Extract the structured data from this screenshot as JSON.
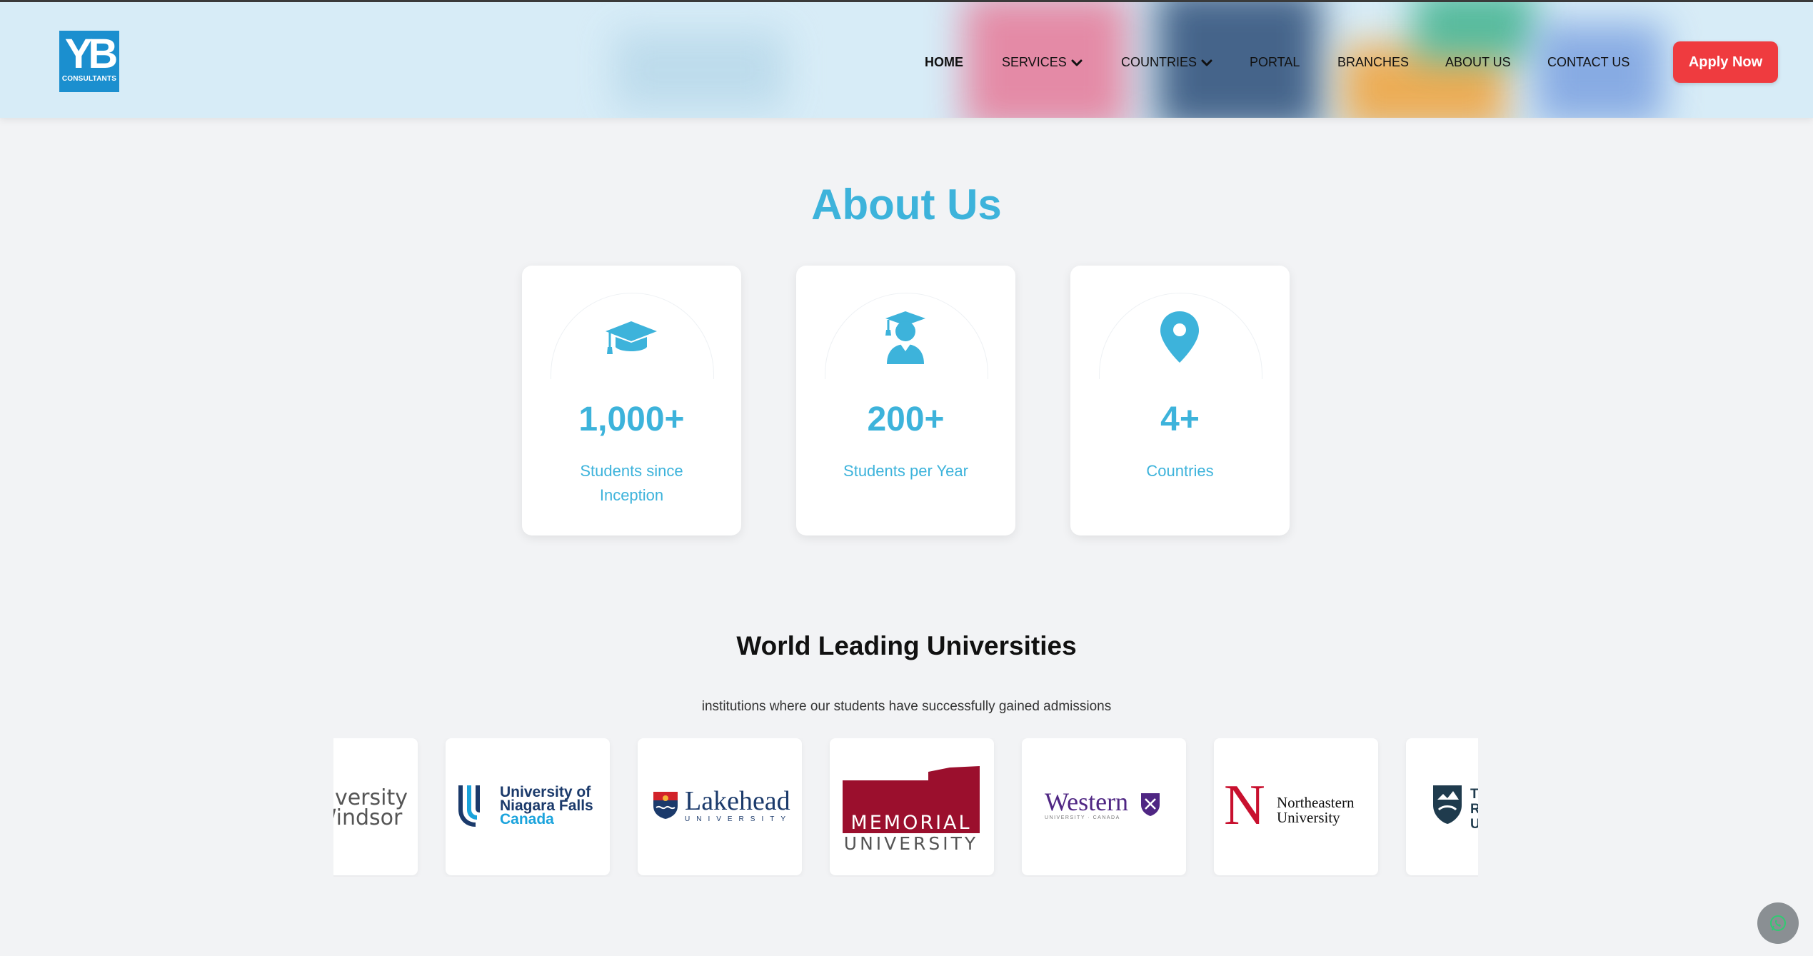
{
  "colors": {
    "accent": "#3db3db",
    "apply_button": "#ef3b3f",
    "header_bg": "#d7ecf7",
    "logo_bg": "#1b8fcf",
    "page_bg": "#f2f3f5"
  },
  "header": {
    "logo": {
      "mark": "YB",
      "subtitle": "CONSULTANTS"
    },
    "nav": [
      {
        "label": "HOME",
        "active": true
      },
      {
        "label": "SERVICES",
        "dropdown": true
      },
      {
        "label": "COUNTRIES",
        "dropdown": true
      },
      {
        "label": "PORTAL"
      },
      {
        "label": "BRANCHES"
      },
      {
        "label": "ABOUT US"
      },
      {
        "label": "CONTACT US"
      }
    ],
    "apply_label": "Apply Now"
  },
  "about": {
    "title": "About Us",
    "stats": [
      {
        "icon": "graduation-cap-icon",
        "value": "1,000+",
        "label": "Students since Inception"
      },
      {
        "icon": "graduate-student-icon",
        "value": "200+",
        "label": "Students per Year"
      },
      {
        "icon": "location-pin-icon",
        "value": "4+",
        "label": "Countries"
      }
    ]
  },
  "universities": {
    "title": "World Leading Universities",
    "subtitle": "institutions where our students have successfully gained admissions",
    "logos": [
      {
        "line1": "niversity",
        "line2": "Windsor"
      },
      {
        "line1": "University of",
        "line2": "Niagara Falls",
        "line3": "Canada"
      },
      {
        "name": "Lakehead",
        "sub": "UNIVERSITY"
      },
      {
        "name": "MEMORIAL",
        "sub": "UNIVERSITY"
      },
      {
        "name": "Western",
        "sub": "UNIVERSITY · CANADA"
      },
      {
        "line1": "Northeastern",
        "line2": "University"
      },
      {
        "line1": "TI",
        "line2": "RI",
        "line3": "UI"
      }
    ]
  },
  "chat": {
    "icon": "whatsapp-icon"
  }
}
